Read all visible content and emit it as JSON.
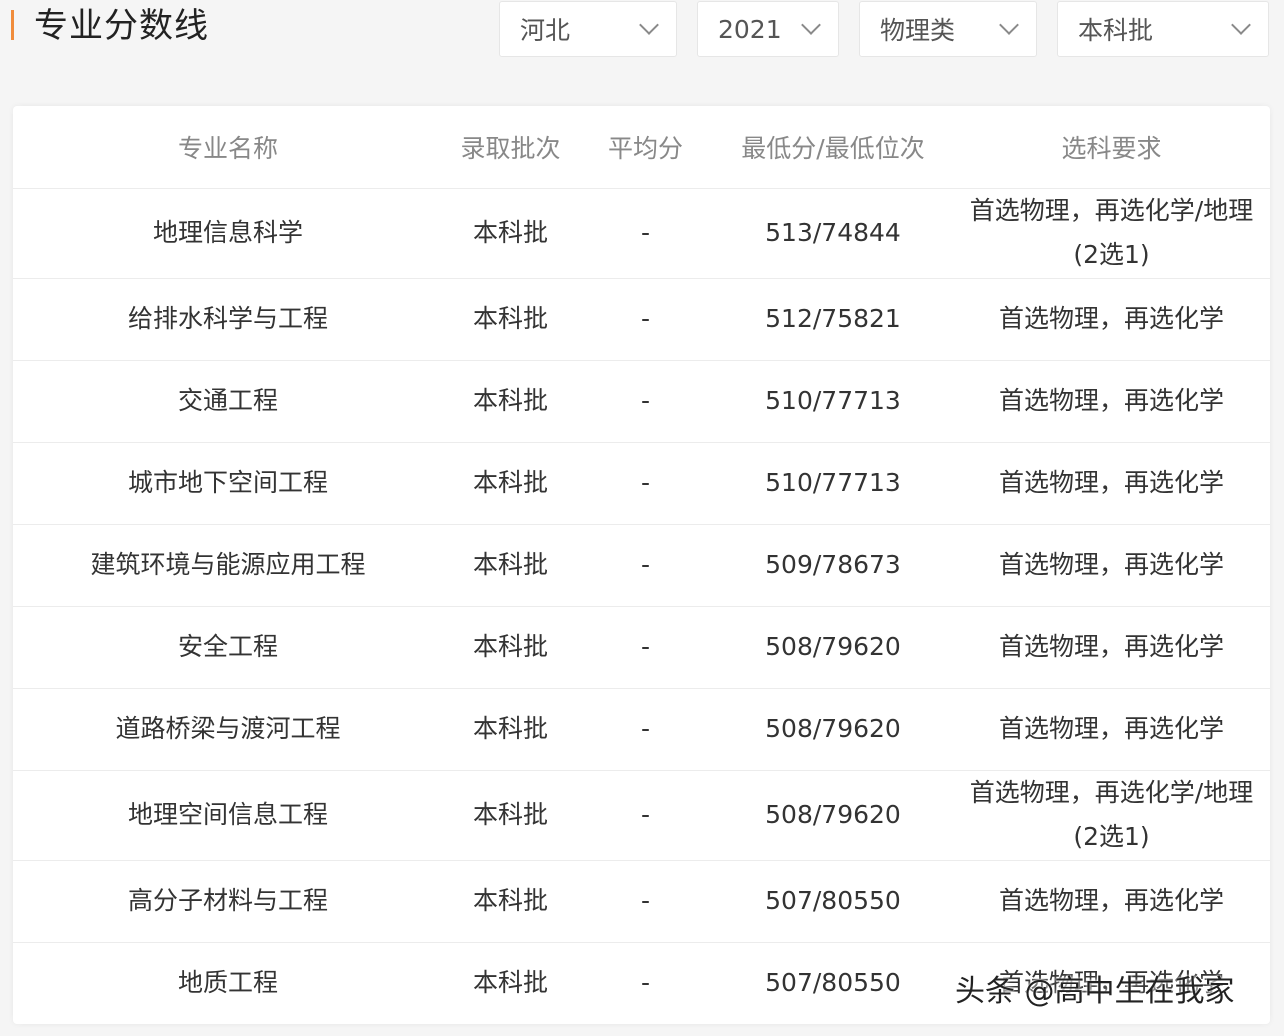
{
  "header": {
    "title": "专业分数线",
    "filters": {
      "province": "河北",
      "year": "2021",
      "subject": "物理类",
      "batch": "本科批"
    }
  },
  "table": {
    "columns": [
      "专业名称",
      "录取批次",
      "平均分",
      "最低分/最低位次",
      "选科要求"
    ],
    "rows": [
      {
        "major": "地理信息科学",
        "batch": "本科批",
        "avg": "-",
        "min": "513/74844",
        "req": "首选物理，再选化学/地理(2选1)"
      },
      {
        "major": "给排水科学与工程",
        "batch": "本科批",
        "avg": "-",
        "min": "512/75821",
        "req": "首选物理，再选化学"
      },
      {
        "major": "交通工程",
        "batch": "本科批",
        "avg": "-",
        "min": "510/77713",
        "req": "首选物理，再选化学"
      },
      {
        "major": "城市地下空间工程",
        "batch": "本科批",
        "avg": "-",
        "min": "510/77713",
        "req": "首选物理，再选化学"
      },
      {
        "major": "建筑环境与能源应用工程",
        "batch": "本科批",
        "avg": "-",
        "min": "509/78673",
        "req": "首选物理，再选化学"
      },
      {
        "major": "安全工程",
        "batch": "本科批",
        "avg": "-",
        "min": "508/79620",
        "req": "首选物理，再选化学"
      },
      {
        "major": "道路桥梁与渡河工程",
        "batch": "本科批",
        "avg": "-",
        "min": "508/79620",
        "req": "首选物理，再选化学"
      },
      {
        "major": "地理空间信息工程",
        "batch": "本科批",
        "avg": "-",
        "min": "508/79620",
        "req": "首选物理，再选化学/地理(2选1)"
      },
      {
        "major": "高分子材料与工程",
        "batch": "本科批",
        "avg": "-",
        "min": "507/80550",
        "req": "首选物理，再选化学"
      },
      {
        "major": "地质工程",
        "batch": "本科批",
        "avg": "-",
        "min": "507/80550",
        "req": "首选物理，再选化学"
      }
    ]
  },
  "watermark": "头条 @高中生在我家",
  "colors": {
    "accent": "#f08c3c"
  }
}
